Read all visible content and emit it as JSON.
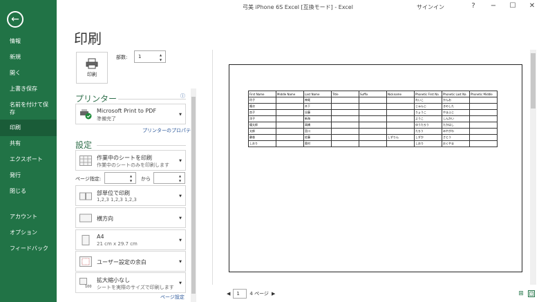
{
  "window": {
    "title": "弓美 iPhone 6S Excel  [互換モード] - Excel",
    "signin": "サインイン",
    "help": "?",
    "minimize": "−",
    "restore": "☐",
    "close": "✕"
  },
  "nav": {
    "back_glyph": "←",
    "items": [
      {
        "label": "情報"
      },
      {
        "label": "新規"
      },
      {
        "label": "開く"
      },
      {
        "label": "上書き保存"
      },
      {
        "label": "名前を付けて保存"
      },
      {
        "label": "印刷",
        "active": true
      },
      {
        "label": "共有"
      },
      {
        "label": "エクスポート"
      },
      {
        "label": "発行"
      },
      {
        "label": "閉じる"
      },
      {
        "label": "アカウント"
      },
      {
        "label": "オプション"
      },
      {
        "label": "フィードバック"
      }
    ]
  },
  "print": {
    "title": "印刷",
    "button_label": "印刷",
    "copies_label": "部数:",
    "copies_value": "1"
  },
  "printer": {
    "section": "プリンター",
    "name": "Microsoft Print to PDF",
    "status": "準備完了",
    "props_link": "プリンターのプロパティ",
    "info": "ⓘ"
  },
  "settings": {
    "section": "設定",
    "scope_title": "作業中のシートを印刷",
    "scope_sub": "作業中のシートのみを印刷します",
    "pages_label": "ページ指定:",
    "pages_to": "から",
    "collate_title": "部単位で印刷",
    "collate_sub": "1,2,3    1,2,3    1,2,3",
    "orientation": "横方向",
    "paper_title": "A4",
    "paper_sub": "21 cm x 29.7 cm",
    "margins": "ユーザー設定の余白",
    "scaling_title": "拡大縮小なし",
    "scaling_sub": "シートを実際のサイズで印刷します",
    "page_setup_link": "ページ設定"
  },
  "sheet": {
    "headers": [
      "First Name",
      "Middle Name",
      "Last Name",
      "Title",
      "Suffix",
      "Nickname",
      "Phonetic First Na",
      "Phonetic Last Na",
      "Phonetic Middle"
    ],
    "rows": [
      [
        "玲子",
        "",
        "神尾",
        "",
        "",
        "",
        "れいこ",
        "かんお",
        ""
      ],
      [
        "隆次",
        "",
        "木下",
        "",
        "",
        "",
        "じゅんじ",
        "きのした",
        ""
      ],
      [
        "良子",
        "",
        "谷藤",
        "",
        "",
        "",
        "りょうこ",
        "やまふじ",
        ""
      ],
      [
        "洋子",
        "",
        "新海",
        "",
        "",
        "",
        "ようこ",
        "しんかい",
        ""
      ],
      [
        "優太郎",
        "",
        "高橋",
        "",
        "",
        "",
        "ゆうたろう",
        "たかはし",
        ""
      ],
      [
        "太郎",
        "",
        "宮川",
        "",
        "",
        "",
        "たろう",
        "みやがわ",
        ""
      ],
      [
        "静香",
        "",
        "佐藤",
        "",
        "",
        "しずりん",
        "しずか",
        "さとう",
        ""
      ],
      [
        "しおり",
        "",
        "奥村",
        "",
        "",
        "",
        "しおり",
        "おくやま",
        ""
      ]
    ]
  },
  "pager": {
    "prev": "◀",
    "current": "1",
    "of": "4 ページ",
    "next": "▶"
  }
}
